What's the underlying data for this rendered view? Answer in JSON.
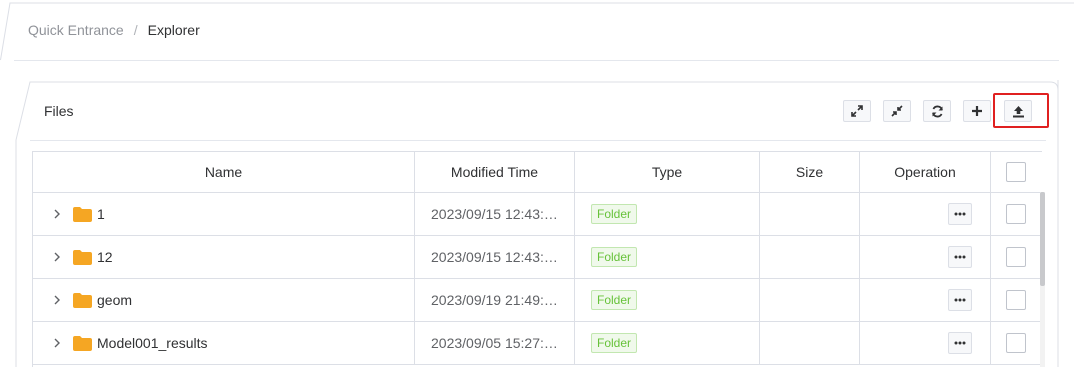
{
  "breadcrumb": {
    "items": [
      "Quick Entrance",
      "Explorer"
    ],
    "separator": "/"
  },
  "card": {
    "title": "Files"
  },
  "toolbar": {
    "buttons": [
      {
        "name": "expand-all",
        "icon": "expand-arrows-icon"
      },
      {
        "name": "collapse-all",
        "icon": "collapse-arrows-icon"
      },
      {
        "name": "refresh",
        "icon": "refresh-icon"
      },
      {
        "name": "add",
        "icon": "plus-icon"
      },
      {
        "name": "upload",
        "icon": "upload-icon",
        "highlighted": true
      }
    ],
    "highlight_color": "#e02020"
  },
  "table": {
    "columns": [
      "Name",
      "Modified Time",
      "Type",
      "Size",
      "Operation"
    ],
    "rows": [
      {
        "name": "1",
        "modified": "2023/09/15 12:43:…",
        "type": "Folder",
        "size": ""
      },
      {
        "name": "12",
        "modified": "2023/09/15 12:43:…",
        "type": "Folder",
        "size": ""
      },
      {
        "name": "geom",
        "modified": "2023/09/19 21:49:…",
        "type": "Folder",
        "size": ""
      },
      {
        "name": "Model001_results",
        "modified": "2023/09/05 15:27:…",
        "type": "Folder",
        "size": ""
      }
    ]
  },
  "colors": {
    "folder": "#f5a623",
    "tag_text": "#67c23a",
    "tag_bg": "#f0f9eb",
    "tag_border": "#c2e7b0",
    "border": "#dcdfe6"
  }
}
